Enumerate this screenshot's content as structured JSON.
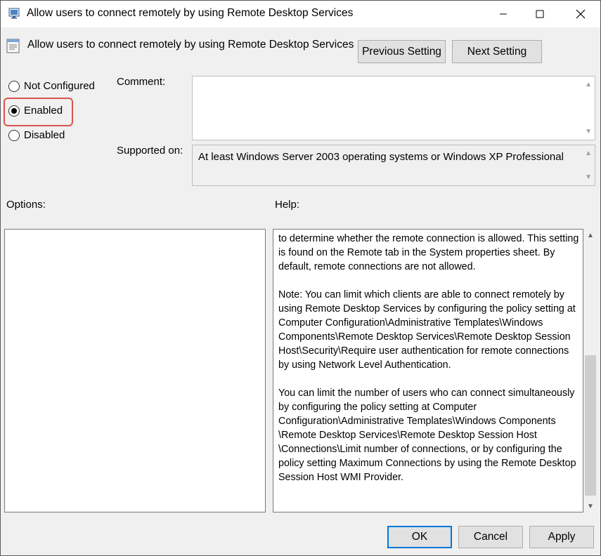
{
  "window": {
    "title": "Allow users to connect remotely by using Remote Desktop Services",
    "minimize_icon": "minimize-icon",
    "maximize_icon": "maximize-icon",
    "close_icon": "close-icon"
  },
  "header": {
    "policy_name": "Allow users to connect remotely by using Remote Desktop Services",
    "icon": "policy-setting-icon",
    "previous_label": "Previous Setting",
    "next_label": "Next Setting"
  },
  "state": {
    "options": [
      {
        "label": "Not Configured",
        "checked": false
      },
      {
        "label": "Enabled",
        "checked": true
      },
      {
        "label": "Disabled",
        "checked": false
      }
    ],
    "highlight_color": "#d9534f"
  },
  "comment": {
    "label": "Comment:",
    "value": ""
  },
  "supported": {
    "label": "Supported on:",
    "value": "At least Windows Server 2003 operating systems or Windows XP Professional"
  },
  "options_panel": {
    "label": "Options:"
  },
  "help": {
    "label": "Help:",
    "paragraphs": [
      "to determine whether the remote connection is allowed. This setting is found on the Remote tab in the System properties sheet. By default, remote connections are not allowed.",
      "Note: You can limit which clients are able to connect remotely by using Remote Desktop Services by configuring the policy setting at Computer Configuration\\Administrative Templates\\Windows Components\\Remote Desktop Services\\Remote Desktop Session Host\\Security\\Require user authentication for remote connections by using Network Level Authentication.",
      "You can limit the number of users who can connect simultaneously by configuring the policy setting at Computer Configuration\\Administrative Templates\\Windows Components \\Remote Desktop Services\\Remote Desktop Session Host \\Connections\\Limit number of connections, or by configuring the policy setting Maximum Connections by using the Remote Desktop Session Host WMI Provider."
    ]
  },
  "footer": {
    "ok_label": "OK",
    "cancel_label": "Cancel",
    "apply_label": "Apply"
  },
  "colors": {
    "accent": "#0078d7",
    "background": "#f0f0f0"
  }
}
